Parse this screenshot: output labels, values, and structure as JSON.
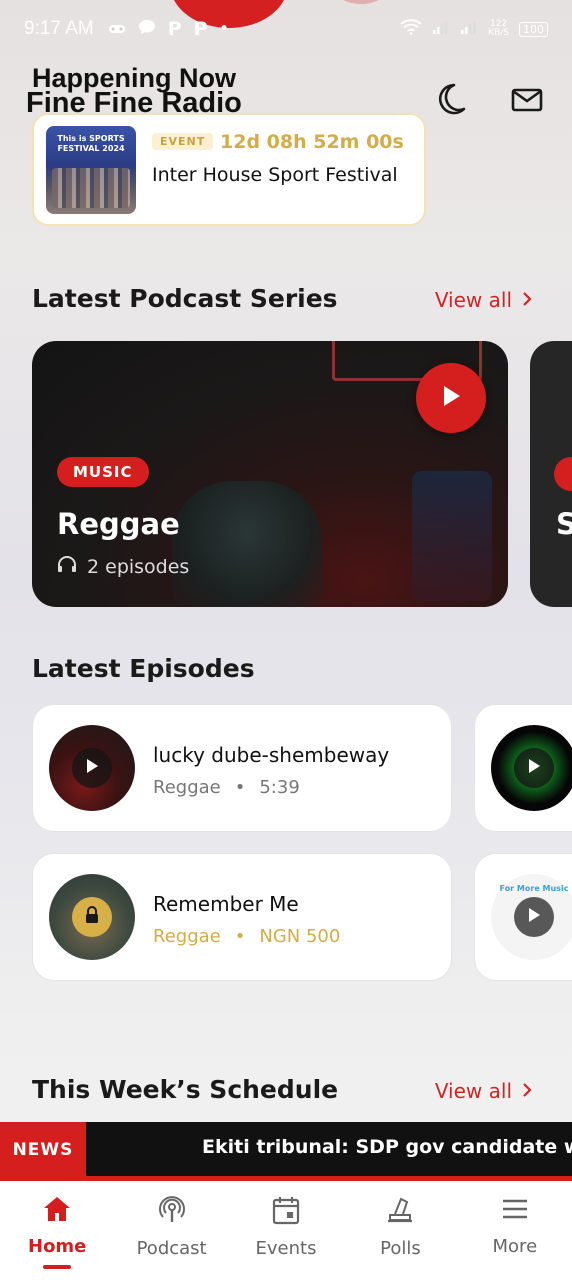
{
  "status_bar": {
    "time": "9:17 AM",
    "left_icons": [
      "game-icon",
      "chat-icon",
      "p-icon",
      "p-icon",
      "dot"
    ],
    "network_speed": "122\nKB/S",
    "battery": "100"
  },
  "header": {
    "section_label": "Happening Now",
    "brand": "Fine Fine Radio",
    "icons": [
      "moon-icon",
      "mail-icon"
    ]
  },
  "event": {
    "badge": "EVENT",
    "countdown": "12d 08h 52m 00s",
    "name": "Inter House Sport Festival",
    "thumb_text": "This is SPORTS FESTIVAL 2024"
  },
  "podcast_section": {
    "title": "Latest Podcast Series",
    "view_all": "View all",
    "cards": [
      {
        "tag": "MUSIC",
        "name": "Reggae",
        "episodes": "2 episodes"
      },
      {
        "name": "S"
      }
    ]
  },
  "episodes_section": {
    "title": "Latest Episodes",
    "items": [
      {
        "title": "lucky dube-shembeway",
        "genre": "Reggae",
        "separator": "•",
        "detail": "5:39",
        "locked": false
      },
      {
        "title": "Remember Me",
        "genre": "Reggae",
        "separator": "•",
        "detail": "NGN 500",
        "locked": true
      }
    ],
    "peek_text": "For More Music"
  },
  "schedule_section": {
    "title": "This Week’s Schedule",
    "view_all": "View all"
  },
  "news": {
    "label": "NEWS",
    "headline": "Ekiti tribunal: SDP gov candidate withdraws petition"
  },
  "bottom_nav": [
    {
      "label": "Home",
      "icon": "home-icon",
      "active": true
    },
    {
      "label": "Podcast",
      "icon": "podcast-icon",
      "active": false
    },
    {
      "label": "Events",
      "icon": "calendar-icon",
      "active": false
    },
    {
      "label": "Polls",
      "icon": "polls-icon",
      "active": false
    },
    {
      "label": "More",
      "icon": "menu-icon",
      "active": false
    }
  ],
  "colors": {
    "accent": "#d51e1e",
    "gold": "#d4ad48"
  }
}
